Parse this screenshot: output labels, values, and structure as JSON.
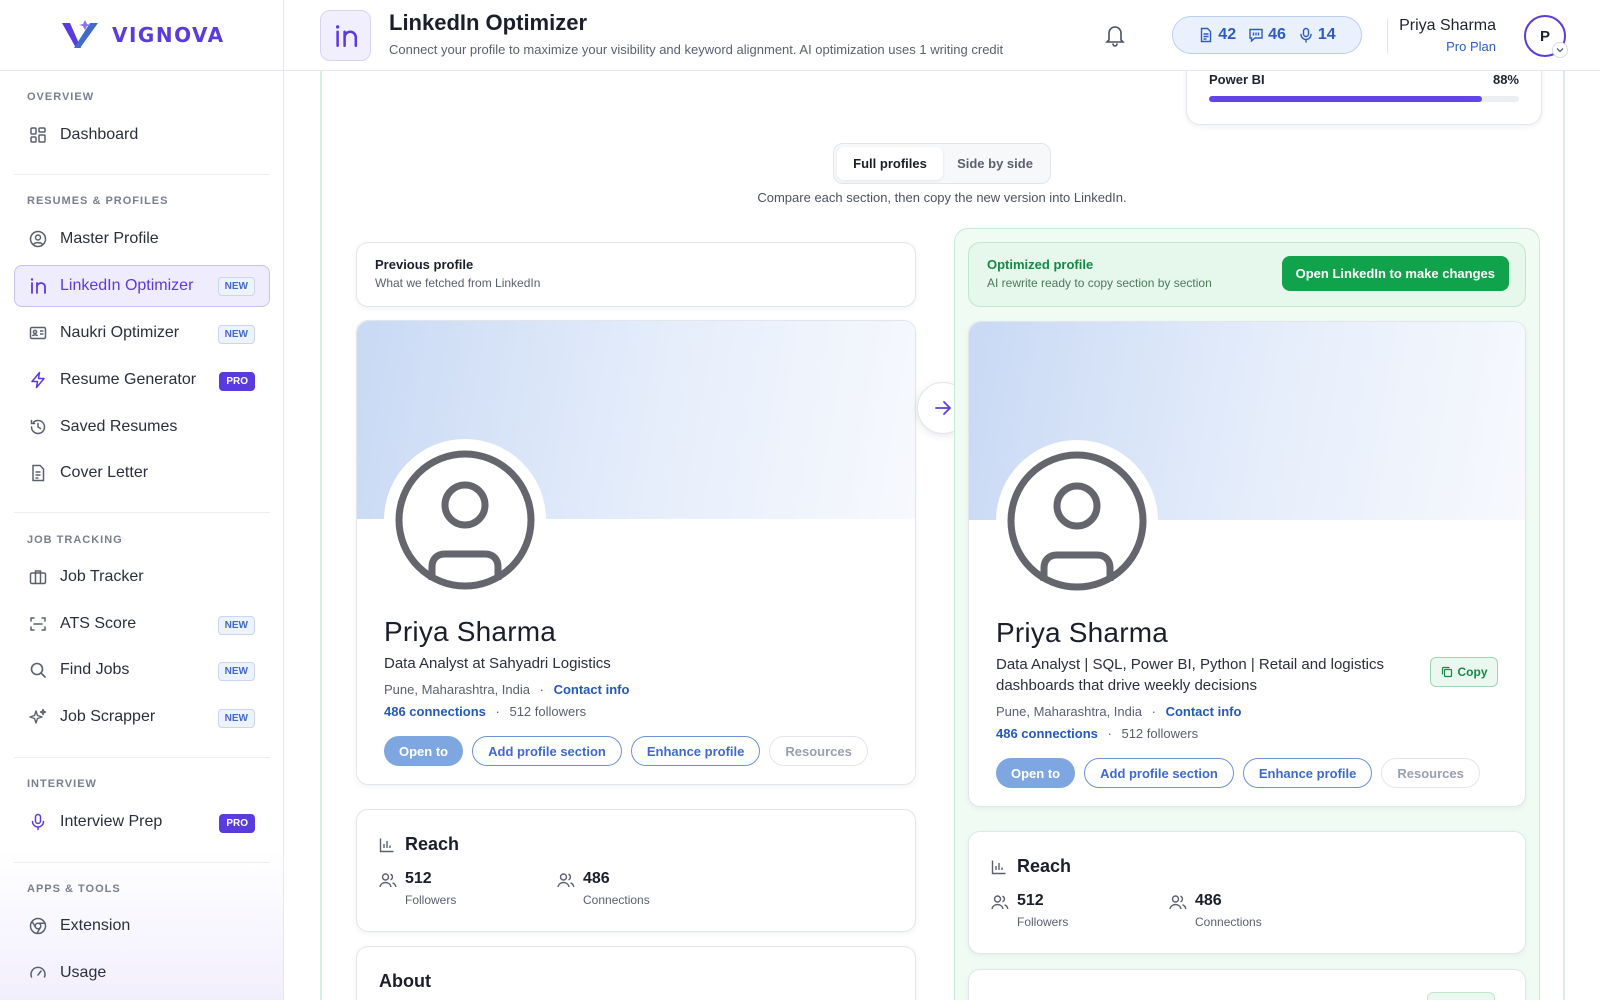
{
  "brand": {
    "name": "VIGNOVA"
  },
  "sidebar": {
    "sections": {
      "overview": "OVERVIEW",
      "resumes": "RESUMES & PROFILES",
      "jobs": "JOB TRACKING",
      "interview": "INTERVIEW",
      "apps": "APPS & TOOLS"
    },
    "items": {
      "dashboard": {
        "label": "Dashboard"
      },
      "master_profile": {
        "label": "Master Profile"
      },
      "linkedin": {
        "label": "LinkedIn Optimizer",
        "badge": "NEW"
      },
      "naukri": {
        "label": "Naukri Optimizer",
        "badge": "NEW"
      },
      "resume_gen": {
        "label": "Resume Generator",
        "badge": "PRO"
      },
      "saved": {
        "label": "Saved Resumes"
      },
      "cover": {
        "label": "Cover Letter"
      },
      "job_tracker": {
        "label": "Job Tracker"
      },
      "ats": {
        "label": "ATS Score",
        "badge": "NEW"
      },
      "find_jobs": {
        "label": "Find Jobs",
        "badge": "NEW"
      },
      "scrapper": {
        "label": "Job Scrapper",
        "badge": "NEW"
      },
      "interview_prep": {
        "label": "Interview Prep",
        "badge": "PRO"
      },
      "extension": {
        "label": "Extension"
      },
      "usage": {
        "label": "Usage"
      }
    }
  },
  "header": {
    "title": "LinkedIn Optimizer",
    "subtitle": "Connect your profile to maximize your visibility and keyword alignment. AI optimization uses 1 writing credit",
    "credits": {
      "documents": "42",
      "messages": "46",
      "voice": "14"
    },
    "user": {
      "name": "Priya Sharma",
      "plan": "Pro Plan",
      "initial": "P"
    }
  },
  "skill": {
    "name": "Power BI",
    "percent_label": "88%",
    "percent": 88
  },
  "view_toggle": {
    "full": "Full profiles",
    "side": "Side by side",
    "selected": "Full profiles"
  },
  "hint": "Compare each section, then copy the new version into LinkedIn.",
  "previous": {
    "title": "Previous profile",
    "subtitle": "What we fetched from LinkedIn",
    "name": "Priya Sharma",
    "headline": "Data Analyst at Sahyadri Logistics",
    "location": "Pune, Maharashtra, India",
    "contact": "Contact info",
    "connections": "486 connections",
    "followers": "512 followers"
  },
  "optimized": {
    "title": "Optimized profile",
    "subtitle": "AI rewrite ready to copy section by section",
    "open_button": "Open LinkedIn to make changes",
    "name": "Priya Sharma",
    "headline": "Data Analyst | SQL, Power BI, Python | Retail and logistics dashboards that drive weekly decisions",
    "location": "Pune, Maharashtra, India",
    "contact": "Contact info",
    "connections": "486 connections",
    "followers": "512 followers",
    "copy": "Copy"
  },
  "separator": "·",
  "buttons": {
    "open_to": "Open to",
    "add_section": "Add profile section",
    "enhance": "Enhance profile",
    "resources": "Resources"
  },
  "reach": {
    "title": "Reach",
    "followers_value": "512",
    "followers_label": "Followers",
    "connections_value": "486",
    "connections_label": "Connections"
  },
  "about": {
    "title": "About"
  },
  "colors": {
    "brand": "#5a3be0",
    "link": "#2559b8",
    "success": "#10a34b",
    "accent_blue": "#2c5bc4"
  }
}
